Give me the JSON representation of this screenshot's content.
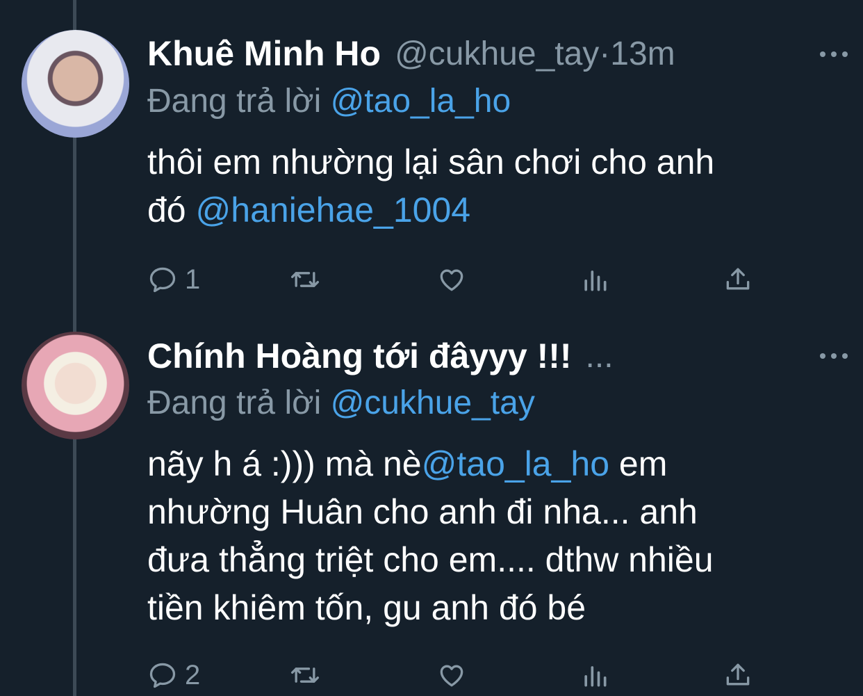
{
  "tweets": [
    {
      "name": "Khuê Minh Ho",
      "handle": "@cukhue_tay",
      "time_sep": " · ",
      "time": "13m",
      "reply_prefix": "Đang trả lời ",
      "reply_to": "@tao_la_ho",
      "text_1": "thôi em nhường lại sân chơi cho anh",
      "text_2": "đó ",
      "text_mention": "@haniehae_1004",
      "reply_count": "1"
    },
    {
      "name": "Chính Hoàng tới đâyyy !!!",
      "handle_trunc": "...",
      "reply_prefix": "Đang trả lời ",
      "reply_to": "@cukhue_tay",
      "text_1a": "nãy h á :))) mà nè",
      "text_mention": "@tao_la_ho",
      "text_1b": " em",
      "text_2": "nhường Huân cho anh đi nha... anh",
      "text_3": "đưa thẳng triệt cho em.... dthw nhiều",
      "text_4": "tiền khiêm tốn, gu anh đó bé",
      "reply_count": "2"
    }
  ],
  "icons": [
    "reply-icon",
    "retweet-icon",
    "like-icon",
    "analytics-icon",
    "share-icon",
    "more-icon"
  ],
  "colors": {
    "background": "#15202b",
    "secondary_text": "#8899a6",
    "link": "#4aa3e8"
  }
}
